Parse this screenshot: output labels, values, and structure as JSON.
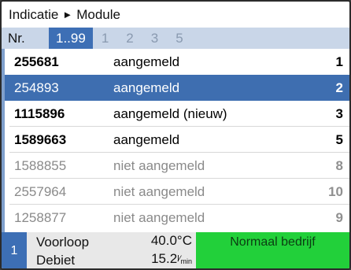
{
  "title": {
    "left": "Indicatie",
    "arrow": "►",
    "right": "Module"
  },
  "tabs": {
    "nr": "Nr.",
    "active": "1..99",
    "others": [
      "1",
      "2",
      "3",
      "5"
    ]
  },
  "rows": [
    {
      "number": "255681",
      "status": "aangemeld",
      "index": "1",
      "selected": false,
      "dim": false
    },
    {
      "number": "254893",
      "status": "aangemeld",
      "index": "2",
      "selected": true,
      "dim": false
    },
    {
      "number": "1115896",
      "status": "aangemeld (nieuw)",
      "index": "3",
      "selected": false,
      "dim": false
    },
    {
      "number": "1589663",
      "status": "aangemeld",
      "index": "5",
      "selected": false,
      "dim": false
    },
    {
      "number": "1588855",
      "status": "niet aangemeld",
      "index": "8",
      "selected": false,
      "dim": true
    },
    {
      "number": "2557964",
      "status": "niet aangemeld",
      "index": "10",
      "selected": false,
      "dim": true
    },
    {
      "number": "1258877",
      "status": "niet aangemeld",
      "index": "9",
      "selected": false,
      "dim": true
    }
  ],
  "status_panel": {
    "zone": "1",
    "flow_label": "Voorloop",
    "flow_value": "40.0°C",
    "debit_label": "Debiet",
    "debit_value": "15.2",
    "debit_unit_num": "l",
    "debit_unit_den": "min",
    "mode": "Normaal bedrijf"
  },
  "colors": {
    "selection": "#3e6eb0",
    "tabbar": "#c9d6e8",
    "mode_green": "#22d03a"
  }
}
